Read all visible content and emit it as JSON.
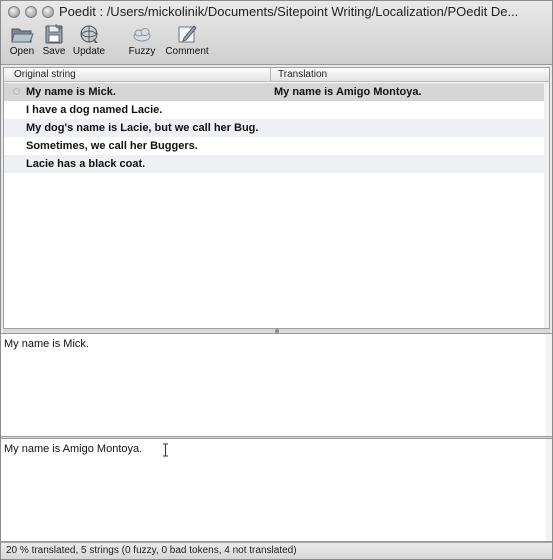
{
  "window": {
    "title": "Poedit : /Users/mickolinik/Documents/Sitepoint Writing/Localization/POedit De..."
  },
  "toolbar": {
    "open_label": "Open",
    "save_label": "Save",
    "update_label": "Update",
    "fuzzy_label": "Fuzzy",
    "comment_label": "Comment"
  },
  "list": {
    "columns": [
      "Original string",
      "Translation"
    ],
    "rows": [
      {
        "original": "My name is Mick.",
        "translation": "My name is Amigo Montoya.",
        "selected": true
      },
      {
        "original": "I have a dog named Lacie.",
        "translation": ""
      },
      {
        "original": "My dog's name is Lacie, but we call her Bug.",
        "translation": ""
      },
      {
        "original": "Sometimes, we call her Buggers.",
        "translation": ""
      },
      {
        "original": "Lacie has a black coat.",
        "translation": ""
      }
    ]
  },
  "source_pane": {
    "text": "My name is Mick."
  },
  "translation_pane": {
    "text": "My name is Amigo Montoya."
  },
  "status": {
    "text": "20 % translated, 5 strings (0 fuzzy, 0 bad tokens, 4 not translated)"
  },
  "colors": {
    "selected_row": "#d6d6d6",
    "alternate_row": "#eef0f3",
    "toolbar_gradient_top": "#e9e9e9",
    "toolbar_gradient_bottom": "#cfcfcf"
  },
  "icons": [
    "folder-open-icon",
    "floppy-disk-icon",
    "update-globe-icon",
    "fuzzy-cloud-icon",
    "comment-pencil-icon",
    "text-cursor-icon"
  ]
}
